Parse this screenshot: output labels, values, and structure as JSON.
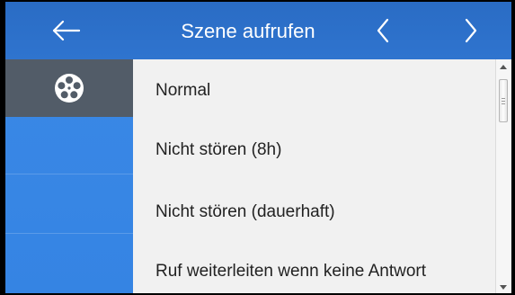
{
  "header": {
    "back_icon": "arrow-left-icon",
    "title": "Szene aufrufen",
    "prev_icon": "chevron-left-icon",
    "next_icon": "chevron-right-icon"
  },
  "sidebar": {
    "items": [
      {
        "icon": "film-reel-icon",
        "active": true
      },
      {
        "active": false
      },
      {
        "active": false
      },
      {
        "active": false
      }
    ]
  },
  "scenes": {
    "items": [
      {
        "label": "Normal"
      },
      {
        "label": "Nicht stören (8h)"
      },
      {
        "label": "Nicht stören (dauerhaft)"
      },
      {
        "label": "Ruf weiterleiten wenn keine Antwort"
      }
    ]
  },
  "colors": {
    "header": "#2f74cf",
    "sidebar": "#3584e3",
    "sidebar_active": "#525c68",
    "list_background": "#f1f1f1"
  }
}
